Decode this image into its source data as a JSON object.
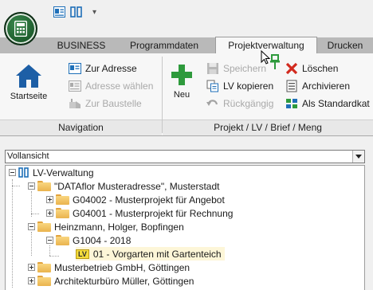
{
  "tabs": [
    {
      "label": "BUSINESS",
      "active": false
    },
    {
      "label": "Programmdaten",
      "active": false
    },
    {
      "label": "Projektverwaltung",
      "active": true
    },
    {
      "label": "Drucken",
      "active": false
    }
  ],
  "ribbon": {
    "navigation": {
      "label": "Navigation",
      "startseite": "Startseite",
      "zur_adresse": "Zur Adresse",
      "adresse_waehlen": "Adresse wählen",
      "zur_baustelle": "Zur Baustelle"
    },
    "projekt": {
      "label": "Projekt / LV / Brief / Meng",
      "neu": "Neu",
      "speichern": "Speichern",
      "loeschen": "Löschen",
      "lv_kopieren": "LV kopieren",
      "archivieren": "Archivieren",
      "rueckgaengig": "Rückgängig",
      "als_standard": "Als Standardkat"
    }
  },
  "view_select": {
    "value": "Vollansicht"
  },
  "tree": {
    "root": "LV-Verwaltung",
    "nodes": [
      "\"DATAflor Musteradresse\", Musterstadt",
      "G04002 - Musterprojekt für Angebot",
      "G04001 - Musterprojekt für Rechnung",
      "Heinzmann, Holger, Bopfingen",
      "G1004 - 2018",
      "01 - Vorgarten mit Gartenteich",
      "Musterbetrieb GmbH, Göttingen",
      "Architekturbüro Müller, Göttingen"
    ],
    "lv_badge": "LV"
  },
  "colors": {
    "accent_green": "#2e9a3c",
    "tab_strip": "#b9b9b9",
    "ribbon_bg": "#f7f7f7",
    "folder": "#eab34e"
  }
}
